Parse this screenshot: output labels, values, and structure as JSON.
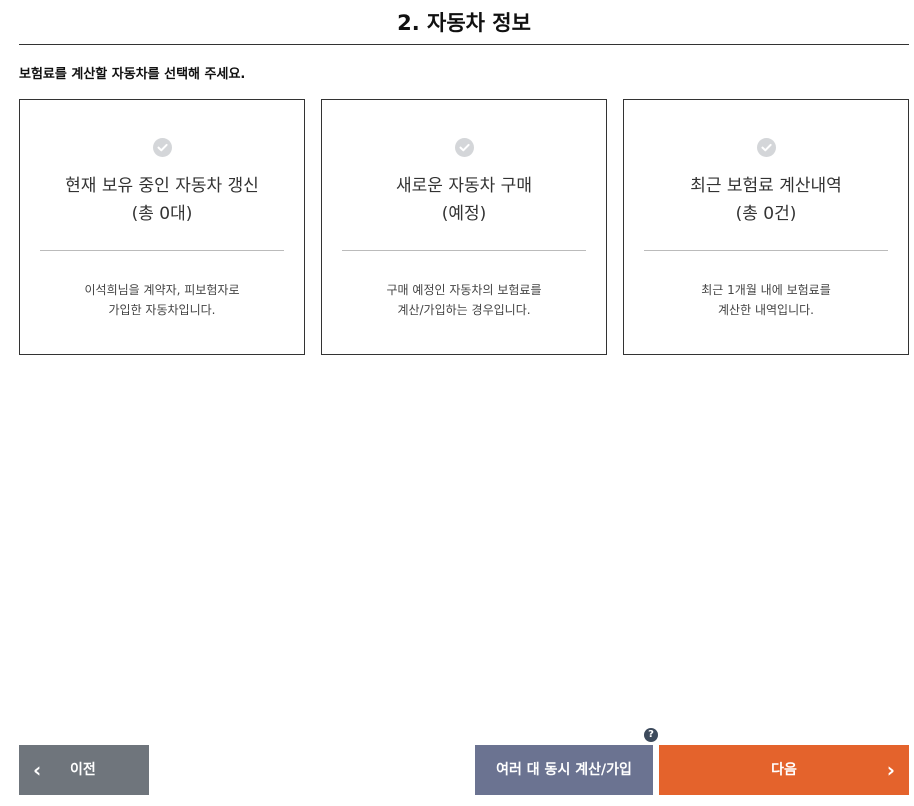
{
  "page": {
    "title": "2. 자동차 정보",
    "instruction": "보험료를 계산할 자동차를 선택해 주세요."
  },
  "cards": [
    {
      "title_line1": "현재 보유 중인 자동차 갱신",
      "title_line2": "(총 0대)",
      "desc_line1": "이석희님을 계약자, 피보험자로",
      "desc_line2": "가입한 자동차입니다."
    },
    {
      "title_line1": "새로운 자동차 구매",
      "title_line2": "(예정)",
      "desc_line1": "구매 예정인 자동차의 보험료를",
      "desc_line2": "계산/가입하는 경우입니다."
    },
    {
      "title_line1": "최근 보험료 계산내역",
      "title_line2": "(총 0건)",
      "desc_line1": "최근 1개월 내에 보험료를",
      "desc_line2": "계산한 내역입니다."
    }
  ],
  "footer": {
    "prev_label": "이전",
    "prev_chevron": "‹",
    "multi_label": "여러 대 동시 계산/가입",
    "help_glyph": "?",
    "next_label": "다음",
    "next_chevron": "›"
  },
  "icons": {
    "card_check": "check-circle-icon",
    "help": "question-icon",
    "prev": "chevron-left-icon",
    "next": "chevron-right-icon"
  },
  "colors": {
    "prev_button": "#6f757c",
    "multi_button": "#6b7391",
    "next_button": "#e4632c",
    "check_circle": "#d4d6d9",
    "help_badge": "#3d4a5c"
  }
}
